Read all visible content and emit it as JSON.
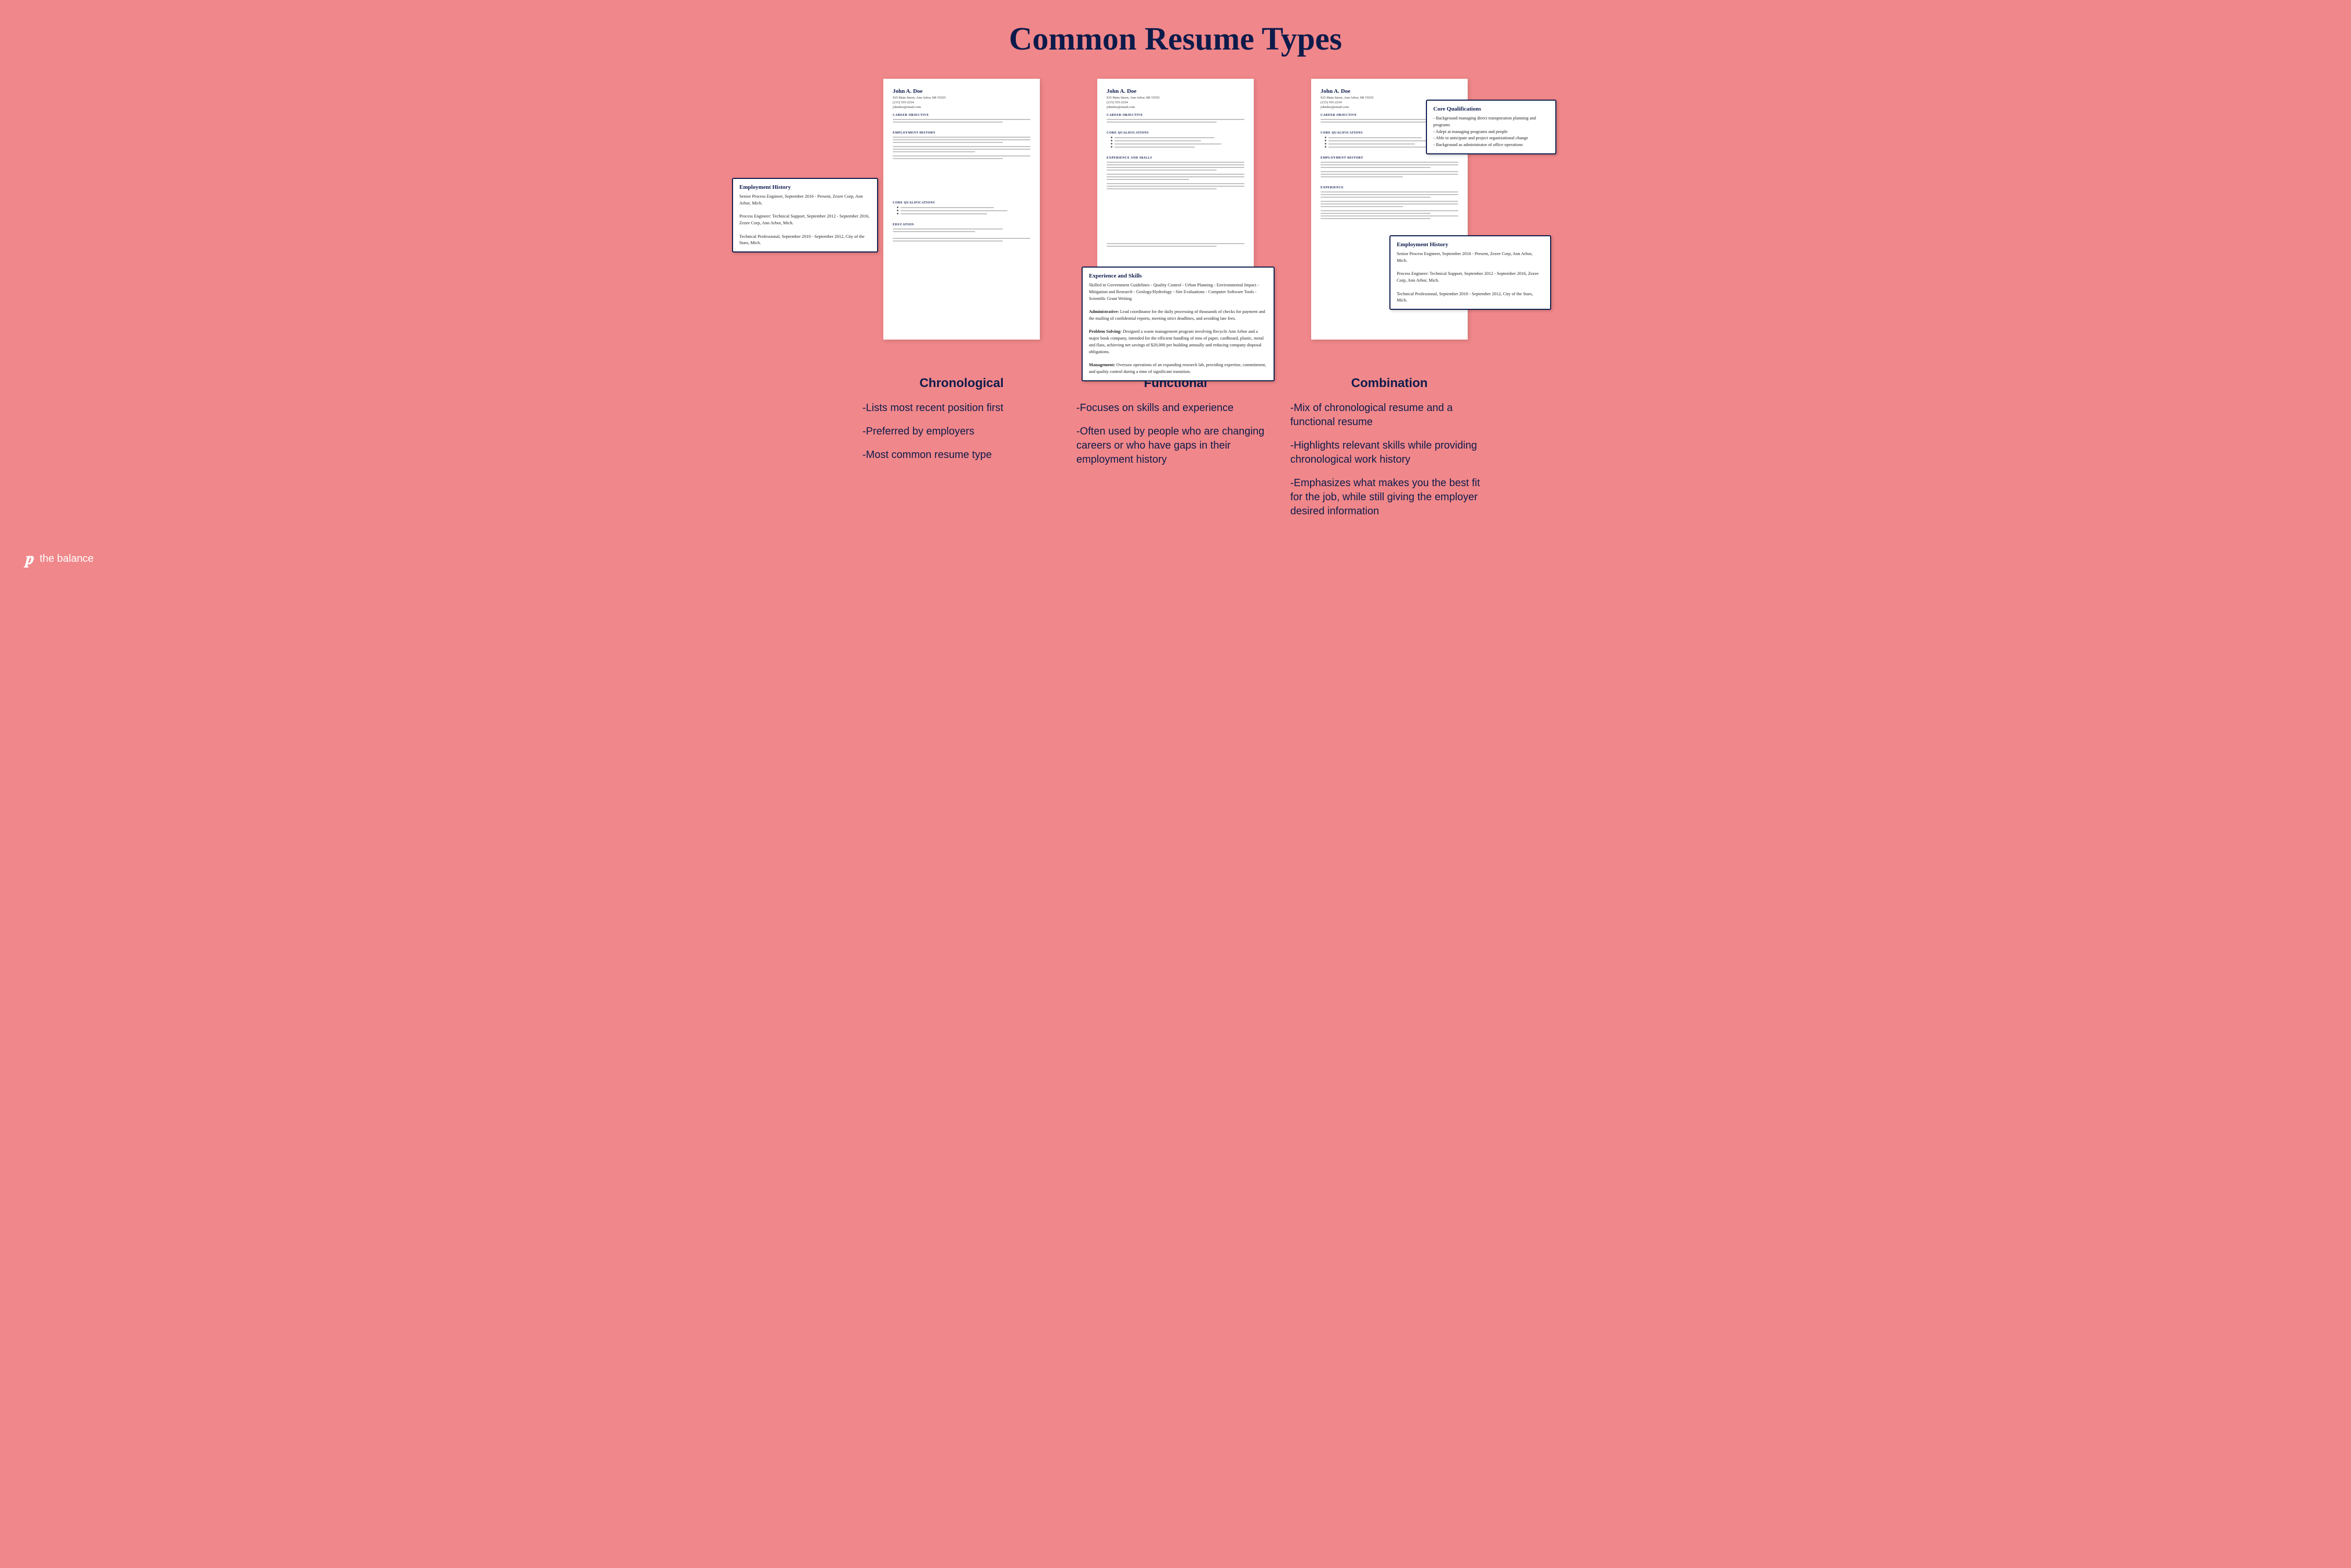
{
  "page": {
    "title": "Common Resume Types",
    "background_color": "#f0878a"
  },
  "resumes": [
    {
      "id": "chronological",
      "name": "John A. Doe",
      "address": "935 Main Street, Ann Arbor, MI 55555",
      "phone": "(215) 555-2234",
      "email": "johndoe@email.com",
      "sections": [
        "CAREER OBJECTIVE",
        "EMPLOYMENT HISTORY",
        "CORE QUALIFICATIONS",
        "EDUCATION"
      ],
      "callout": {
        "title": "Employment History",
        "lines": [
          "Senior Process Engineer, September 2016 - Present, Zezee Corp, Ann Arbor, Mich.",
          "Process Engineer: Technical Support, September 2012 - September 2016, Zezee Corp, Ann Arbor, Mich.",
          "Technical Professional, September 2010 - September 2012, City of the Stars, Mich."
        ]
      }
    },
    {
      "id": "functional",
      "name": "John A. Doe",
      "address": "935 Main Street, Ann Arbor, MI 55555",
      "phone": "(215) 555-2234",
      "email": "johndoe@email.com",
      "sections": [
        "CAREER OBJECTIVE",
        "CORE QUALIFICATIONS",
        "EXPERIENCE AND SKILLS"
      ],
      "callout": {
        "title": "Experience and Skills",
        "lines": [
          "Skilled in Government Guidelines - Quality Control - Urban Planning - Environmental Impact - Mitigation and Research - Geology/Hydrology - Site Evaluations - Computer Software Tools - Scientific Grant Writing",
          "Administrative: Lead coordinator for the daily processing of thousands of checks for payment and the mailing of confidential reports, meeting strict deadlines, and avoiding late fees.",
          "Problem Solving: Designed a waste management program involving Recycle Ann Arbor and a major book company, intended for the efficient handling of tons of paper, cardboard, plastic, metal and flass, achieving net savings of $20,000 per building annually and reducing company disposal obligations.",
          "Management: Oversaw operations of an expanding research lab, providing expertise, commitment, and quality control during a time of significant transition."
        ]
      }
    },
    {
      "id": "combination",
      "name": "John A. Doe",
      "address": "935 Main Street, Ann Arbor, MI 55555",
      "phone": "(215) 555-2234",
      "email": "johndoe@email.com",
      "sections": [
        "CAREER OBJECTIVE",
        "CORE QUALIFICATIONS",
        "EMPLOYMENT HISTORY",
        "EXPERIENCE"
      ],
      "callout_top": {
        "title": "Core Qualifications",
        "lines": [
          "- Background managing direct transporation planning and programs",
          "- Adept at managing programs and people",
          "- Able to anticipate and project organizational change",
          "- Background as administrator of office operations"
        ]
      },
      "callout_bottom": {
        "title": "Employment History",
        "lines": [
          "Senior Process Engineer, September 2016 - Present, Zezee Corp, Ann Arbor, Mich.",
          "Process Engineer: Technical Support, September 2012 - September 2016, Zezee Corp, Ann Arbor, Mich.",
          "Technical Professional, September 2010 - September 2012, City of the Stars, Mich."
        ]
      }
    }
  ],
  "descriptions": [
    {
      "type": "Chronological",
      "items": [
        "-Lists most recent position first",
        "-Preferred by employers",
        "-Most common resume type"
      ]
    },
    {
      "type": "Functional",
      "items": [
        "-Focuses on skills and experience",
        "-Often used by people who are changing careers or who have gaps in their employment history"
      ]
    },
    {
      "type": "Combination",
      "items": [
        "-Mix of chronological resume and a functional resume",
        "-Highlights relevant skills while providing chronological work history",
        "-Emphasizes what makes you the best fit for the job, while still giving the employer desired information"
      ]
    }
  ],
  "footer": {
    "logo_icon": "b",
    "logo_text": "the balance"
  }
}
